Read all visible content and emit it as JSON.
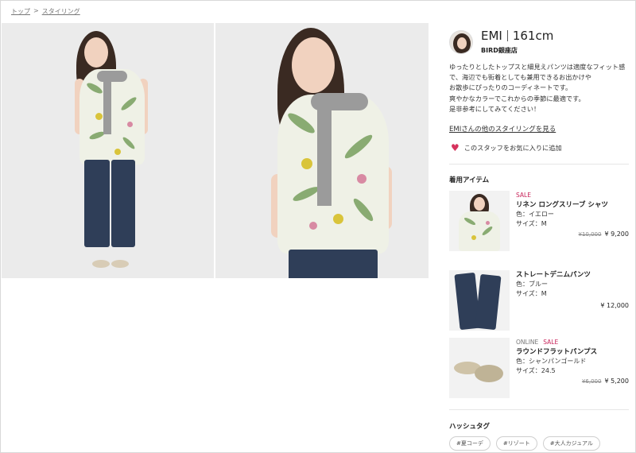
{
  "breadcrumb": {
    "items": [
      "トップ",
      "スタイリング"
    ],
    "separator": ">"
  },
  "staff": {
    "name": "EMI",
    "height": "161cm",
    "shop": "BIRD銀座店",
    "description": [
      "ゆったりとしたトップスと細見えパンツは適度なフィット感",
      "で、海辺でも街着としても兼用できるお出かけや",
      "お散歩にぴったりのコーディネートです。",
      "爽やかなカラーでこれからの季節に最適です。",
      "是非参考にしてみてください！"
    ],
    "more_link": "EMIさんの他のスタイリングを見る",
    "favorite_label": "このスタッフをお気に入りに追加"
  },
  "items_section": {
    "title": "着用アイテム"
  },
  "items": [
    {
      "sale": "SALE",
      "online": "",
      "name": "リネン ロングスリーブ シャツ",
      "color": "色：イエロー",
      "size": "サイズ：M",
      "old_price": "¥10,000",
      "price": "¥ 9,200"
    },
    {
      "sale": "",
      "online": "",
      "name": "ストレートデニムパンツ",
      "color": "色：ブルー",
      "size": "サイズ：M",
      "old_price": "",
      "price": "¥ 12,000"
    },
    {
      "sale": "SALE",
      "online": "ONLINE",
      "name": "ラウンドフラットパンプス",
      "color": "色：シャンパンゴールド",
      "size": "サイズ：24.5",
      "old_price": "¥6,000",
      "price": "¥ 5,200"
    }
  ],
  "hashtag_section": {
    "title": "ハッシュタグ"
  },
  "hashtags": [
    "#夏コーデ",
    "#リゾート",
    "#大人カジュアル"
  ],
  "colors": {
    "accent": "#d6335d",
    "sale": "#c8245a"
  }
}
